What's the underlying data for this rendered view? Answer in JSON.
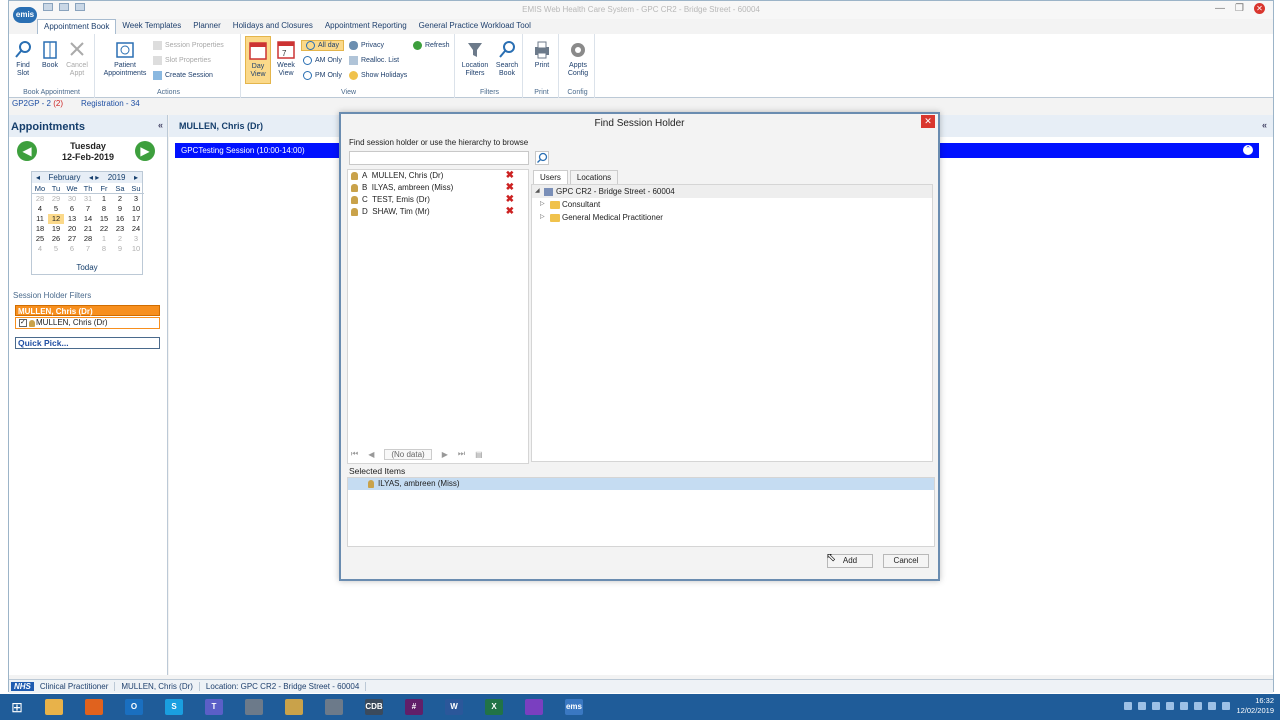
{
  "window": {
    "title": "EMIS Web Health Care System - GPC CR2 - Bridge Street - 60004",
    "app_logo": "emis"
  },
  "menu_tabs": [
    "Appointment Book",
    "Week Templates",
    "Planner",
    "Holidays and Closures",
    "Appointment Reporting",
    "General Practice Workload Tool"
  ],
  "ribbon": {
    "book_appointment": {
      "label": "Book Appointment",
      "find_slot": "Find Slot",
      "book": "Book",
      "cancel_appt": "Cancel Appt"
    },
    "actions": {
      "label": "Actions",
      "patient_appointments": "Patient Appointments",
      "session_properties": "Session Properties",
      "slot_properties": "Slot Properties",
      "create_session": "Create Session"
    },
    "view": {
      "label": "View",
      "day_view": "Day View",
      "week_view": "Week View",
      "all_day": "All day",
      "am_only": "AM Only",
      "pm_only": "PM Only",
      "privacy": "Privacy",
      "realloc_list": "Realloc. List",
      "show_holidays": "Show Holidays",
      "refresh": "Refresh"
    },
    "filters": {
      "label": "Filters",
      "location_filters": "Location Filters",
      "search_book": "Search Book"
    },
    "print": {
      "label": "Print",
      "print": "Print"
    },
    "config": {
      "label": "Config",
      "appts_config": "Appts Config"
    }
  },
  "infobar": {
    "gp2gp": "GP2GP - 2",
    "gp2gp_count": "(2)",
    "registration": "Registration - 34"
  },
  "left_panel": {
    "title": "Appointments",
    "day": "Tuesday",
    "date": "12-Feb-2019",
    "calendar": {
      "month": "February",
      "year": "2019",
      "headers": [
        "Mo",
        "Tu",
        "We",
        "Th",
        "Fr",
        "Sa",
        "Su"
      ],
      "weeks": [
        [
          "28",
          "29",
          "30",
          "31",
          "1",
          "2",
          "3"
        ],
        [
          "4",
          "5",
          "6",
          "7",
          "8",
          "9",
          "10"
        ],
        [
          "11",
          "12",
          "13",
          "14",
          "15",
          "16",
          "17"
        ],
        [
          "18",
          "19",
          "20",
          "21",
          "22",
          "23",
          "24"
        ],
        [
          "25",
          "26",
          "27",
          "28",
          "1",
          "2",
          "3"
        ],
        [
          "4",
          "5",
          "6",
          "7",
          "8",
          "9",
          "10"
        ]
      ],
      "today_label": "Today"
    },
    "session_holder_filters": "Session Holder Filters",
    "selected_filter": "MULLEN, Chris (Dr)",
    "filter_item": "MULLEN, Chris (Dr)",
    "quick_pick": "Quick Pick..."
  },
  "main": {
    "header": "MULLEN, Chris (Dr)",
    "session": "GPCTesting Session (10:00-14:00)"
  },
  "dialog": {
    "title": "Find Session Holder",
    "hint": "Find session holder or use the hierarchy to browse",
    "search_value": "",
    "list": [
      {
        "key": "A",
        "name": "MULLEN, Chris (Dr)"
      },
      {
        "key": "B",
        "name": "ILYAS, ambreen (Miss)"
      },
      {
        "key": "C",
        "name": "TEST, Emis (Dr)"
      },
      {
        "key": "D",
        "name": "SHAW, Tim (Mr)"
      }
    ],
    "pager_text": "(No data)",
    "tabs": [
      "Users",
      "Locations"
    ],
    "tree": {
      "root": "GPC CR2 - Bridge Street - 60004",
      "children": [
        "Consultant",
        "General Medical Practitioner"
      ]
    },
    "selected_title": "Selected Items",
    "selected_items": [
      "ILYAS, ambreen (Miss)"
    ],
    "add_label": "Add",
    "cancel_label": "Cancel"
  },
  "statusbar": {
    "nhs": "NHS",
    "role": "Clinical Practitioner",
    "user": "MULLEN, Chris (Dr)",
    "location": "Location: GPC CR2 - Bridge Street - 60004"
  },
  "taskbar": {
    "time": "16:32",
    "date": "12/02/2019",
    "apps": [
      {
        "name": "file-explorer-icon",
        "color": "#e8b24a",
        "text": ""
      },
      {
        "name": "firefox-icon",
        "color": "#e0621e",
        "text": ""
      },
      {
        "name": "outlook-icon",
        "color": "#1a6fc0",
        "text": "O"
      },
      {
        "name": "skype-icon",
        "color": "#1a9fe0",
        "text": "S"
      },
      {
        "name": "teams-icon",
        "color": "#5b5fc7",
        "text": "T"
      },
      {
        "name": "pen-icon",
        "color": "#6c7a8a",
        "text": ""
      },
      {
        "name": "person-icon",
        "color": "#c9a24a",
        "text": ""
      },
      {
        "name": "tool-icon",
        "color": "#6c7a8a",
        "text": ""
      },
      {
        "name": "cdb-icon",
        "color": "#3b4a5c",
        "text": "CDB"
      },
      {
        "name": "slack-icon",
        "color": "#611f69",
        "text": "#"
      },
      {
        "name": "word-icon",
        "color": "#2b579a",
        "text": "W"
      },
      {
        "name": "excel-icon",
        "color": "#217346",
        "text": "X"
      },
      {
        "name": "search-app-icon",
        "color": "#7a3fc0",
        "text": ""
      },
      {
        "name": "emis-icon",
        "color": "#3a78c2",
        "text": "ems"
      }
    ]
  }
}
